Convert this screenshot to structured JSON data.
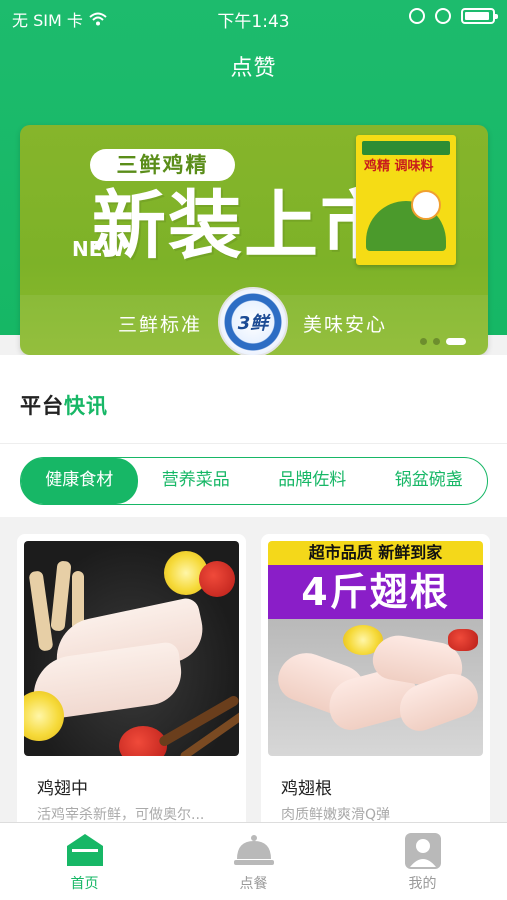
{
  "status_bar": {
    "carrier": "无 SIM 卡",
    "time": "下午1:43"
  },
  "header": {
    "title": "点赞"
  },
  "banner": {
    "tag": "三鲜鸡精",
    "headline": "新装上市",
    "new": "NEW",
    "slogan_left": "三鲜标准",
    "slogan_right": "美味安心",
    "badge": "3鲜",
    "pack_text": "鸡精 调味料",
    "slides_count": 3,
    "active_slide": 3
  },
  "news": {
    "title_a": "平台",
    "title_b": "快讯"
  },
  "tabs": [
    {
      "label": "健康食材",
      "active": true
    },
    {
      "label": "营养菜品",
      "active": false
    },
    {
      "label": "品牌佐料",
      "active": false
    },
    {
      "label": "锅盆碗盏",
      "active": false
    }
  ],
  "products": [
    {
      "name": "鸡翅中",
      "desc": "活鸡宰杀新鲜，可做奥尔..."
    },
    {
      "name": "鸡翅根",
      "desc": "肉质鲜嫩爽滑Q弹",
      "promo_head": "超市品质 新鲜到家",
      "promo_banner": "4斤翅根"
    }
  ],
  "nav": [
    {
      "label": "首页",
      "icon": "home-icon",
      "active": true
    },
    {
      "label": "点餐",
      "icon": "dish-cover-icon",
      "active": false
    },
    {
      "label": "我的",
      "icon": "user-icon",
      "active": false
    }
  ],
  "colors": {
    "brand": "#17b766",
    "banner": "#7db228"
  }
}
